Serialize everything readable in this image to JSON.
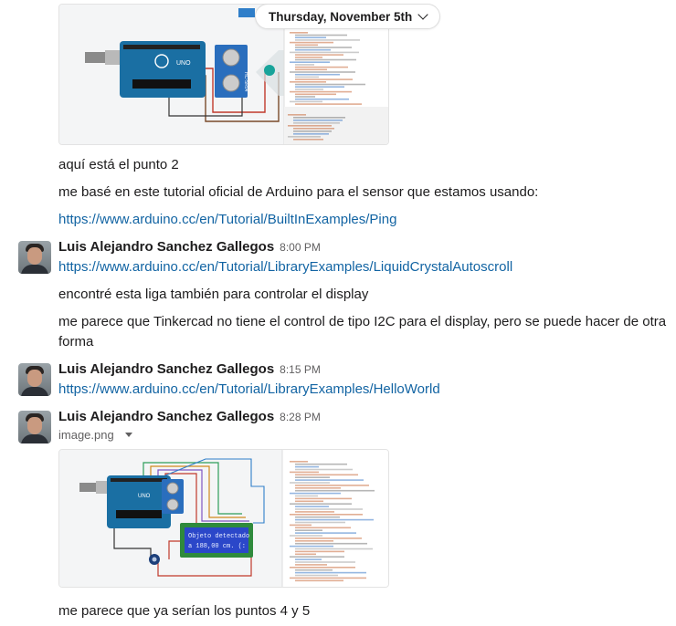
{
  "date_divider": {
    "label": "Thursday, November 5th"
  },
  "messages": {
    "m1": {
      "text": "aquí está el punto 2"
    },
    "m2": {
      "text": "me basé en este tutorial oficial de Arduino para el sensor que estamos usando:"
    },
    "m3": {
      "link": "https://www.arduino.cc/en/Tutorial/BuiltInExamples/Ping"
    },
    "g1": {
      "sender": "Luis Alejandro Sanchez Gallegos",
      "time": "8:00 PM",
      "link": "https://www.arduino.cc/en/Tutorial/LibraryExamples/LiquidCrystalAutoscroll",
      "line2": "encontré esta liga también para controlar el display",
      "line3a": "me parece que Tinkercad no tiene el control de tipo I2C para el display, pero se puede hacer de otra",
      "line3b": "forma"
    },
    "g2": {
      "sender": "Luis Alejandro Sanchez Gallegos",
      "time": "8:15 PM",
      "link": "https://www.arduino.cc/en/Tutorial/LibraryExamples/HelloWorld"
    },
    "g3": {
      "sender": "Luis Alejandro Sanchez Gallegos",
      "time": "8:28 PM",
      "file_name": "image.png",
      "last_text": "me parece que ya serían los puntos 4 y 5"
    }
  },
  "images": {
    "img1": {
      "board_label": "UNO",
      "sensor_label": "HC-SR04"
    },
    "img2": {
      "board_label": "UNO",
      "lcd_line1": "Objeto detectado",
      "lcd_line2": "a 188,00 cm. (:"
    }
  },
  "colors": {
    "link": "#1264a3",
    "text": "#1d1c1d",
    "muted": "#616061",
    "board": "#1a6fa3",
    "sensor": "#2a6ebd",
    "lcd": "#2b47c9"
  }
}
